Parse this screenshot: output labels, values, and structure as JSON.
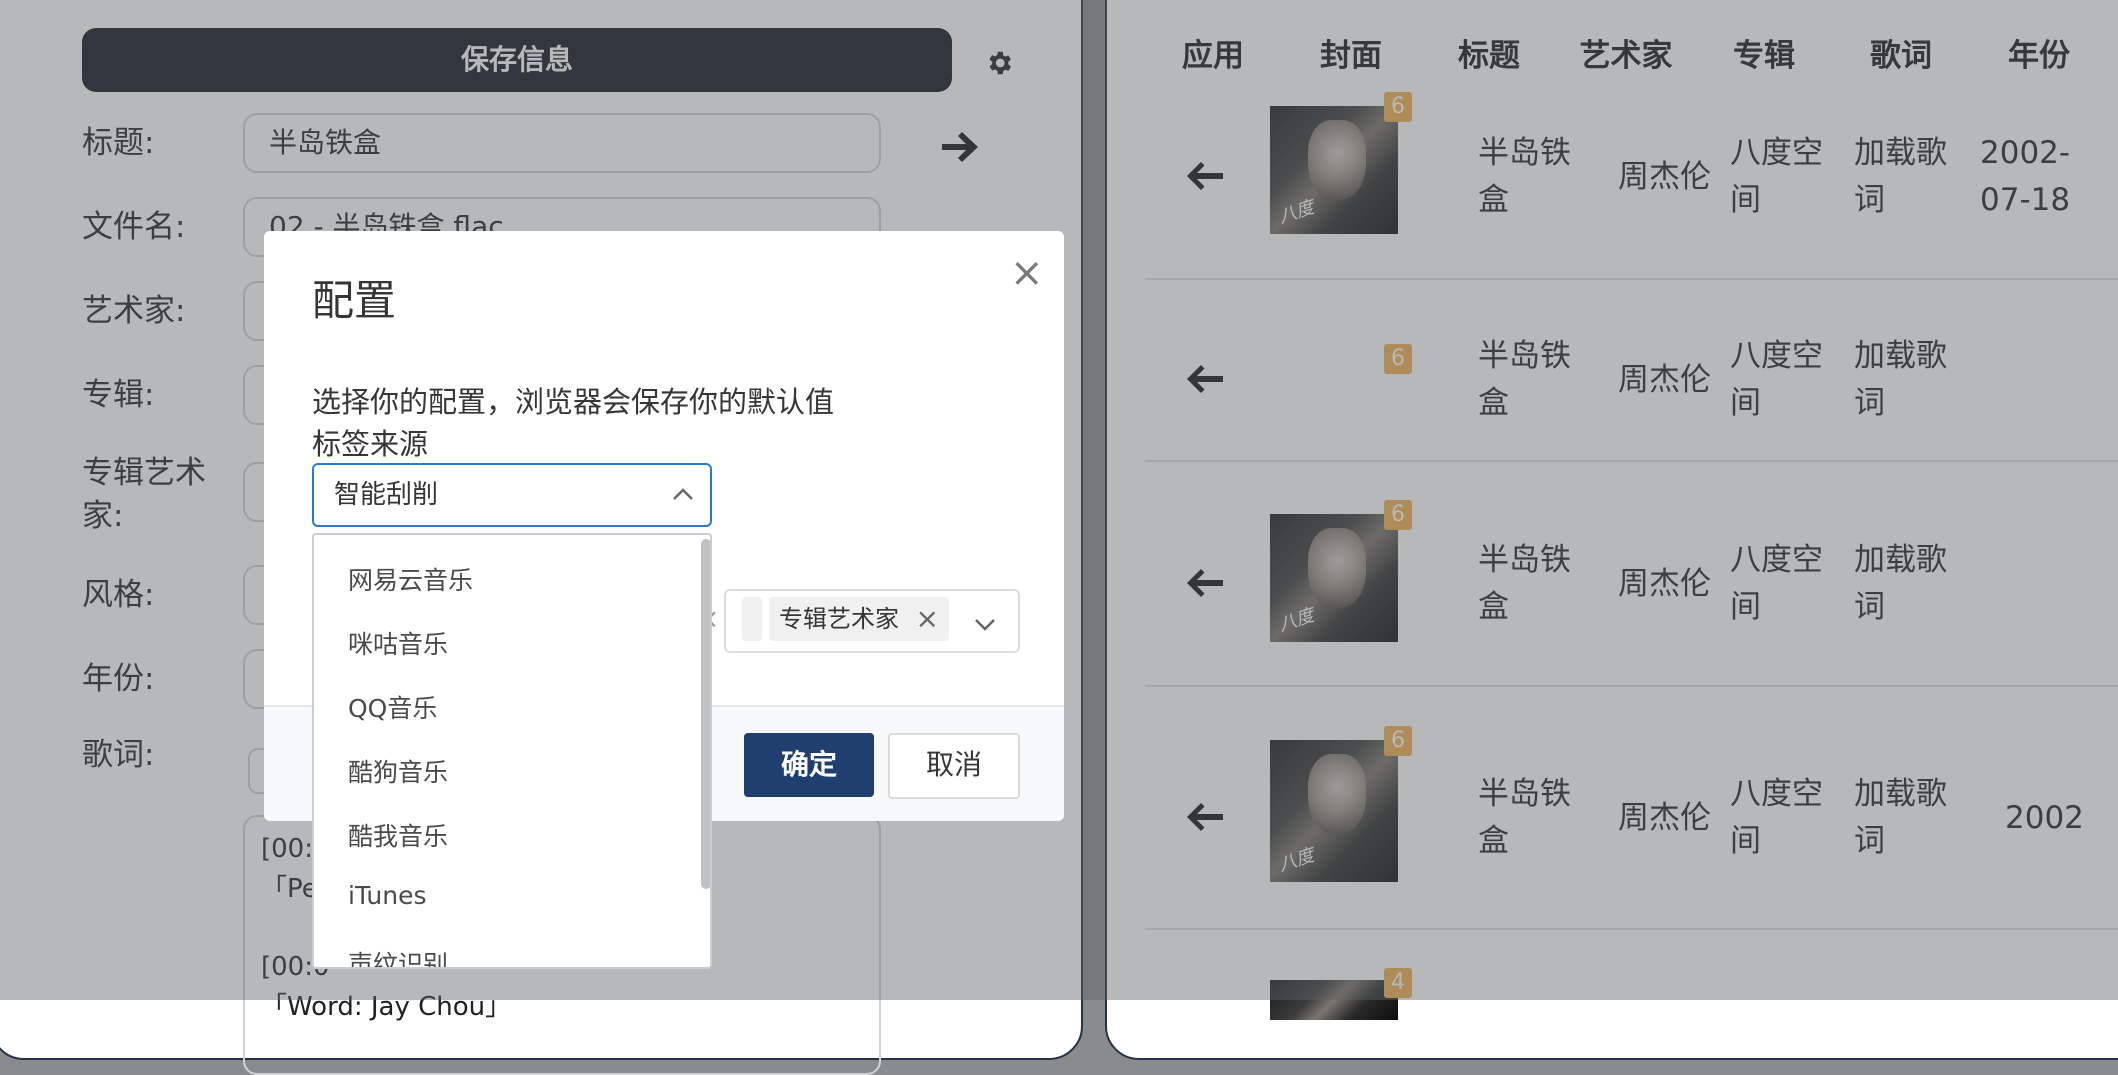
{
  "left_form": {
    "save_label": "保存信息",
    "fields": [
      {
        "label": "标题:",
        "value": "半岛铁盒"
      },
      {
        "label": "文件名:",
        "value": "02 - 半岛铁盒.flac"
      },
      {
        "label": "艺术家:",
        "value": ""
      },
      {
        "label": "专辑:",
        "value": ""
      },
      {
        "label_line1": "专辑艺术",
        "label_line2": "家:",
        "value": ""
      },
      {
        "label": "风格:",
        "value": ""
      },
      {
        "label": "年份:",
        "value": ""
      }
    ],
    "lyrics_label": "歌词:",
    "lyrics_lines": [
      "[00:0",
      "「Pe",
      "[00:0",
      "「Word: Jay Chou」"
    ]
  },
  "table": {
    "headers": [
      "应用",
      "封面",
      "标题",
      "艺术家",
      "专辑",
      "歌词",
      "年份"
    ],
    "rows": [
      {
        "badge": "6",
        "title_l1": "半岛铁",
        "title_l2": "盒",
        "artist": "周杰伦",
        "album_l1": "八度空",
        "album_l2": "间",
        "lyrics_l1": "加载歌",
        "lyrics_l2": "词",
        "year_l1": "2002-",
        "year_l2": "07-18",
        "has_cover": true
      },
      {
        "badge": "6",
        "title_l1": "半岛铁",
        "title_l2": "盒",
        "artist": "周杰伦",
        "album_l1": "八度空",
        "album_l2": "间",
        "lyrics_l1": "加载歌",
        "lyrics_l2": "词",
        "year_l1": "",
        "year_l2": "",
        "has_cover": false
      },
      {
        "badge": "6",
        "title_l1": "半岛铁",
        "title_l2": "盒",
        "artist": "周杰伦",
        "album_l1": "八度空",
        "album_l2": "间",
        "lyrics_l1": "加载歌",
        "lyrics_l2": "词",
        "year_l1": "",
        "year_l2": "",
        "has_cover": true
      },
      {
        "badge": "6",
        "title_l1": "半岛铁",
        "title_l2": "盒",
        "artist": "周杰伦",
        "album_l1": "八度空",
        "album_l2": "间",
        "lyrics_l1": "加载歌",
        "lyrics_l2": "词",
        "year_l1": "2002",
        "year_l2": "",
        "has_cover": true
      },
      {
        "badge": "4",
        "has_cover": true
      }
    ]
  },
  "modal": {
    "title": "配置",
    "close_glyph": "×",
    "description": "选择你的配置，浏览器会保存你的默认值",
    "source_label": "标签来源",
    "selected_source": "智能刮削",
    "source_options": [
      "网易云音乐",
      "咪咕音乐",
      "QQ音乐",
      "酷狗音乐",
      "酷我音乐",
      "iTunes",
      "声纹识别"
    ],
    "tag_partial_x": "×",
    "tag_album_artist": "专辑艺术家",
    "tag_remove_glyph": "×",
    "confirm_label": "确定",
    "cancel_label": "取消"
  },
  "colors": {
    "save_button_bg": "#0e1320",
    "confirm_button_bg": "#1f3f6e",
    "badge_bg": "#f0ad4e",
    "select_focus_border": "#2b7bd3"
  },
  "icons": {
    "settings": "gear-icon",
    "apply_right": "arrow-right-icon",
    "apply_left": "arrow-left-icon",
    "close": "close-icon",
    "chevron_up": "chevron-up-icon",
    "chevron_down": "chevron-down-icon"
  }
}
